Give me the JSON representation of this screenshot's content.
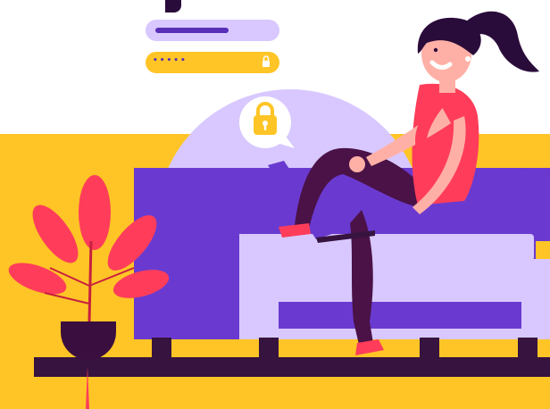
{
  "illustration": {
    "colors": {
      "background_yellow": "#ffc526",
      "white": "#ffffff",
      "sofa_dark_purple": "#6a3ad0",
      "sofa_light_lilac": "#d8c8ff",
      "floor_dark": "#37133f",
      "woman_top_coral": "#ff3d5a",
      "woman_pants_plum": "#4a1247",
      "skin": "#ffb0a6",
      "hair": "#2a0c3b",
      "plant_leaf": "#ff3d5a",
      "pot_dark": "#3a0f3f",
      "laptop_purple": "#6a3ad0"
    },
    "login_form": {
      "username_field_state": "filled",
      "password_mask": "•••••",
      "password_icon": "lock-icon"
    },
    "speech_bubble_icon": "padlock-icon"
  }
}
